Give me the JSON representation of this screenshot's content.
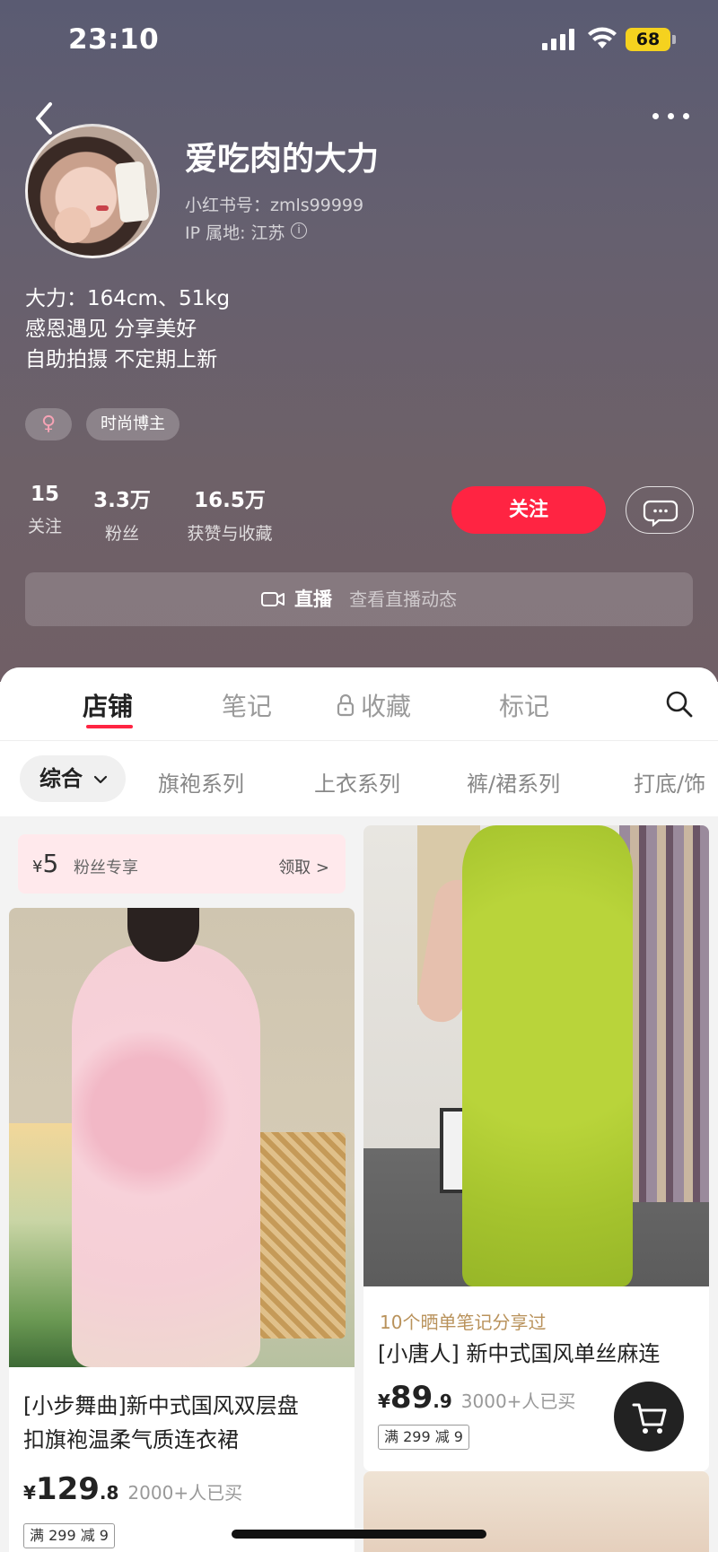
{
  "status_bar": {
    "time": "23:10",
    "battery": "68"
  },
  "profile": {
    "name": "爱吃肉的大力",
    "red_id": "小红书号：zmls99999",
    "ip_location": "IP 属地: 江苏",
    "bio_lines": [
      "大力：164cm、51kg",
      "感恩遇见 分享美好",
      "自助拍摄 不定期上新"
    ],
    "gender_symbol": "♀",
    "tag": "时尚博主"
  },
  "stats": [
    {
      "value": "15",
      "label": "关注"
    },
    {
      "value": "3.3万",
      "label": "粉丝"
    },
    {
      "value": "16.5万",
      "label": "获赞与收藏"
    }
  ],
  "actions": {
    "follow_label": "关注"
  },
  "live": {
    "title": "直播",
    "subtitle": "查看直播动态"
  },
  "tabs": [
    "店铺",
    "笔记",
    "收藏",
    "标记"
  ],
  "filters": {
    "active": "综合",
    "items": [
      "旗袍系列",
      "上衣系列",
      "裤/裙系列",
      "打底/饰"
    ]
  },
  "coupon": {
    "currency": "¥",
    "amount": "5",
    "desc": "粉丝专享",
    "claim": "领取 >"
  },
  "products": [
    {
      "title_lines": [
        "[小步舞曲]新中式国风双层盘",
        "扣旗袍温柔气质连衣裙"
      ],
      "price_int": "129",
      "price_dec": ".8",
      "sold": "2000+人已买",
      "promo": "满 299 减 9"
    },
    {
      "note_hint": "10个晒单笔记分享过",
      "title_lines": [
        "[小唐人] 新中式国风单丝麻连"
      ],
      "price_int": "89",
      "price_dec": ".9",
      "sold": "3000+人已买",
      "promo": "满 299 减 9"
    }
  ],
  "colors": {
    "accent": "#ff2442",
    "header_bg": "#66606f"
  }
}
